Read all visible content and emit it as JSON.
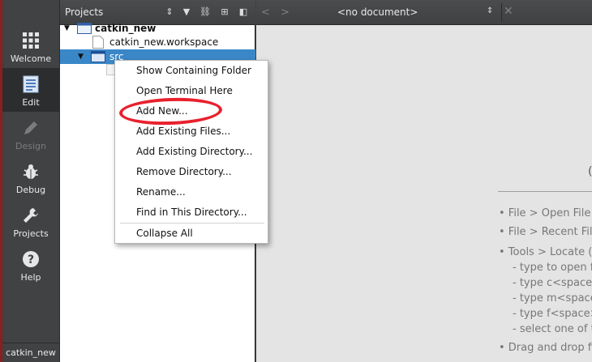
{
  "modes": [
    {
      "label": "Welcome",
      "icon": "grid-icon",
      "state": "normal"
    },
    {
      "label": "Edit",
      "icon": "document-icon",
      "state": "active"
    },
    {
      "label": "Design",
      "icon": "pencil-icon",
      "state": "disabled"
    },
    {
      "label": "Debug",
      "icon": "bug-icon",
      "state": "normal"
    },
    {
      "label": "Projects",
      "icon": "wrench-icon",
      "state": "normal"
    },
    {
      "label": "Help",
      "icon": "help-icon",
      "state": "normal"
    }
  ],
  "active_project": "catkin_new",
  "projects_pane": {
    "title": "Projects",
    "tree": [
      {
        "label": "catkin_new",
        "kind": "project",
        "expanded": true
      },
      {
        "label": "catkin_new.workspace",
        "kind": "file"
      },
      {
        "label": "src",
        "kind": "folder",
        "expanded": true,
        "selected": true
      }
    ]
  },
  "editor": {
    "document": "<no document>",
    "hint_partial_heading": "(",
    "hints": [
      "• File > Open File o",
      "• File > Recent File",
      "• Tools > Locate (C",
      "- type to open fi",
      "- type c<space>",
      "- type m<space>",
      "- type f<space><",
      "- select one of t",
      "• Drag and drop fil"
    ]
  },
  "context_menu": {
    "items": [
      "Show Containing Folder",
      "Open Terminal Here",
      "Add New...",
      "Add Existing Files...",
      "Add Existing Directory...",
      "Remove Directory...",
      "Rename...",
      "Find in This Directory..."
    ],
    "after_separator": "Collapse All",
    "annotated_item": "Add New..."
  },
  "colors": {
    "selection": "#3a87c8",
    "annotation": "#e8212d",
    "sidebar": "#404244"
  }
}
